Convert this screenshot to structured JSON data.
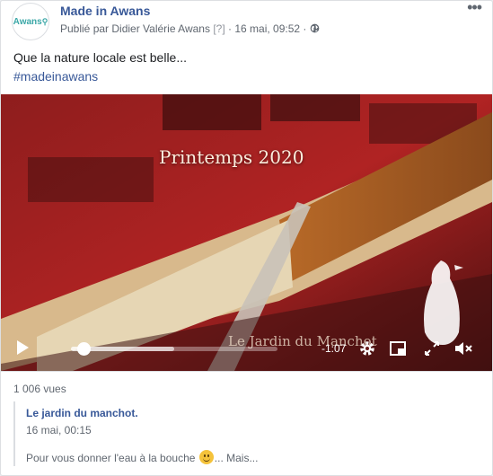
{
  "post": {
    "page_name": "Made in Awans",
    "avatar_text": "Awans",
    "published_by": "Publié par Didier Valérie Awans",
    "help_mark": "[?]",
    "separator": "·",
    "date": "16 mai, 09:52",
    "separator2": "·",
    "text": "Que la nature locale est belle...",
    "hashtag": "#madeinawans"
  },
  "video": {
    "title_overlay": "Printemps 2020",
    "watermark": "Le Jardin du Manchot",
    "time_remaining": "-1:07",
    "progress_fraction": 0.04,
    "buffer_fraction": 0.5
  },
  "stats": {
    "views": "1 006 vues"
  },
  "comment": {
    "author": "Le jardin du manchot.",
    "time": "16 mai, 00:15",
    "text_before": "Pour vous donner l'eau à la bouche",
    "text_after": "... Mais..."
  },
  "icons": {
    "globe": "globe-icon",
    "more": "more-options-icon",
    "play": "play-icon",
    "settings": "gear-icon",
    "pip": "picture-in-picture-icon",
    "fullscreen": "fullscreen-icon",
    "mute": "speaker-muted-icon"
  }
}
